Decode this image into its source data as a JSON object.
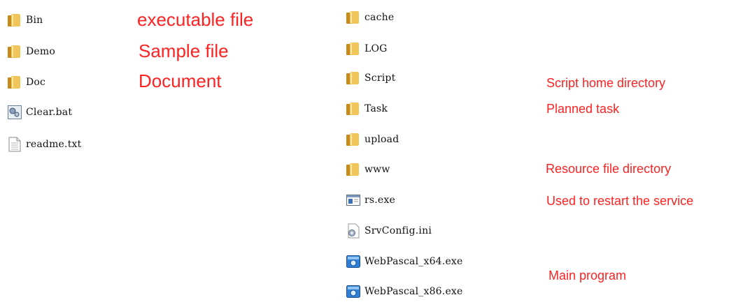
{
  "left_files": [
    {
      "name": "Bin",
      "icon": "folder-icon"
    },
    {
      "name": "Demo",
      "icon": "folder-icon"
    },
    {
      "name": "Doc",
      "icon": "folder-icon"
    },
    {
      "name": "Clear.bat",
      "icon": "batch-file-icon"
    },
    {
      "name": "readme.txt",
      "icon": "text-file-icon"
    }
  ],
  "right_files": [
    {
      "name": "cache",
      "icon": "folder-icon"
    },
    {
      "name": "LOG",
      "icon": "folder-icon"
    },
    {
      "name": "Script",
      "icon": "folder-icon"
    },
    {
      "name": "Task",
      "icon": "folder-icon"
    },
    {
      "name": "upload",
      "icon": "folder-icon"
    },
    {
      "name": "www",
      "icon": "folder-icon"
    },
    {
      "name": "rs.exe",
      "icon": "exe-window-icon"
    },
    {
      "name": "SrvConfig.ini",
      "icon": "config-file-icon"
    },
    {
      "name": "WebPascal_x64.exe",
      "icon": "app-exe-icon"
    },
    {
      "name": "WebPascal_x86.exe",
      "icon": "app-exe-icon"
    }
  ],
  "annotations": {
    "bin": "executable file",
    "demo": "Sample file",
    "doc": "Document",
    "script": "Script home directory",
    "task": "Planned task",
    "www": "Resource file directory",
    "rs": "Used to restart the service",
    "webpascal": "Main program"
  },
  "colors": {
    "annotation": "#ff2222",
    "folder": "#e8b54a"
  }
}
